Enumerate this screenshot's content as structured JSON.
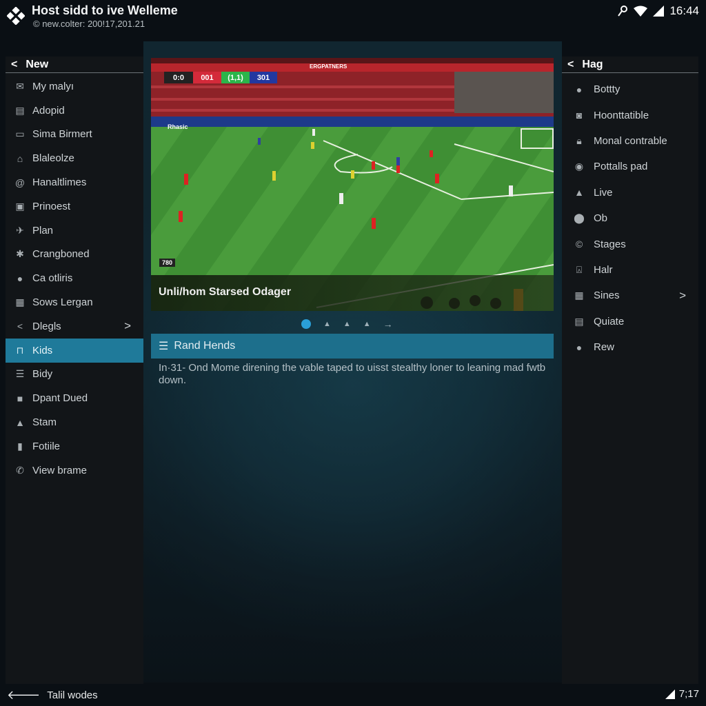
{
  "header": {
    "title": "Host sidd to ive Welleme",
    "subtitle": "© new.colter: 200!17,201.21",
    "time": "16:44"
  },
  "left_sidebar": {
    "title": "New",
    "items": [
      {
        "label": "My malyı",
        "icon": "mail-icon"
      },
      {
        "label": "Adopid",
        "icon": "card-icon"
      },
      {
        "label": "Sima Birmert",
        "icon": "list-icon"
      },
      {
        "label": "Blaleolze",
        "icon": "shirt-icon"
      },
      {
        "label": "Hanaltlimes",
        "icon": "at-icon"
      },
      {
        "label": "Prinoest",
        "icon": "bag-icon"
      },
      {
        "label": "Plan",
        "icon": "plane-icon"
      },
      {
        "label": "Crangboned",
        "icon": "figure-icon"
      },
      {
        "label": "Ca otliris",
        "icon": "info-icon"
      },
      {
        "label": "Sows Lergan",
        "icon": "grid-icon"
      },
      {
        "label": "Dlegls",
        "icon": "chevron-left-icon",
        "chevron": true
      },
      {
        "label": "Kids",
        "icon": "box-icon",
        "selected": true
      },
      {
        "label": "Bidy",
        "icon": "document-icon"
      },
      {
        "label": "Dpant Dued",
        "icon": "gift-icon"
      },
      {
        "label": "Stam",
        "icon": "person-icon"
      },
      {
        "label": "Fotiile",
        "icon": "bottle-icon"
      },
      {
        "label": "View brame",
        "icon": "phone-icon"
      }
    ]
  },
  "right_sidebar": {
    "title": "Hag",
    "items": [
      {
        "label": "Bottty",
        "icon": "pin-icon"
      },
      {
        "label": "Hoonttatible",
        "icon": "badge-icon"
      },
      {
        "label": "Monal contrable",
        "icon": "lock-icon"
      },
      {
        "label": "Pottalls pad",
        "icon": "disc-icon"
      },
      {
        "label": "Live",
        "icon": "person-icon"
      },
      {
        "label": "Ob",
        "icon": "location-icon"
      },
      {
        "label": "Stages",
        "icon": "copyright-icon"
      },
      {
        "label": "Halr",
        "icon": "lock-outline-icon"
      },
      {
        "label": "Sines",
        "icon": "calendar-icon",
        "chevron": true
      },
      {
        "label": "Quiate",
        "icon": "card-icon"
      },
      {
        "label": "Rew",
        "icon": "info-icon"
      }
    ]
  },
  "video": {
    "caption": "Unli/hom Starsed Odager",
    "scoreboard": [
      "0:0",
      "001",
      "(1,1)",
      "301"
    ],
    "ad_board": "Rhasic",
    "banner": "ERGPATNERS",
    "mini_score": "780"
  },
  "carousel": {
    "active_index": 0,
    "count": 4
  },
  "section": {
    "title": "Rand Hends",
    "description": "In·31- Ond Mome direning the vable taped to uisst stealthy loner to leaning mad fwtb down."
  },
  "footer": {
    "back_label": "Talil wodes",
    "time": "7;17"
  },
  "colors": {
    "accent": "#1f7a9a",
    "section_bar": "#1d6f8c",
    "dot_active": "#2a9fd8",
    "pitch": "#3f8f34"
  }
}
